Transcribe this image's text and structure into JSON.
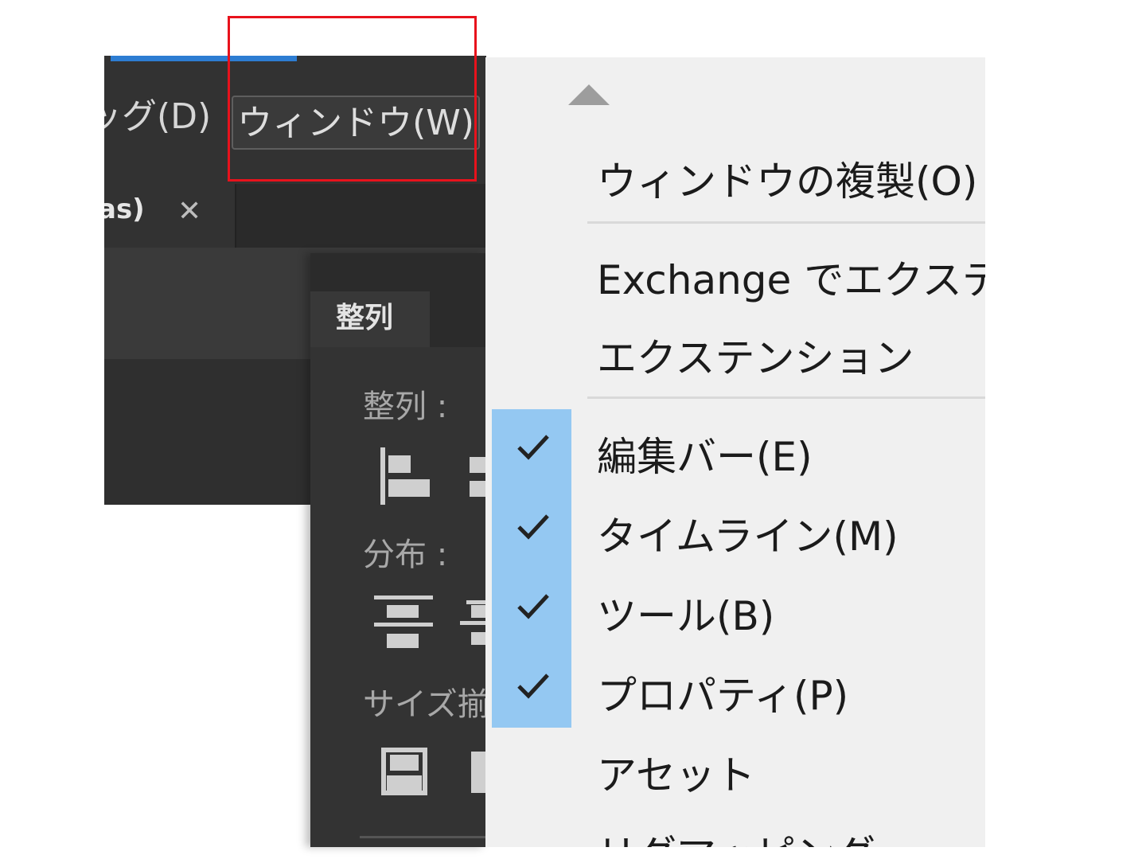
{
  "app": {
    "menubar": {
      "debug_label": "ッグ(D)",
      "window_label": "ウィンドウ(W)"
    },
    "tab": {
      "label": "as)",
      "close_glyph": "✕"
    }
  },
  "align_panel": {
    "tab_label": "整列",
    "align_label": "整列 :",
    "distribute_label": "分布 :",
    "size_label": "サイズ揃"
  },
  "context_menu": {
    "items": [
      {
        "label": "ウィンドウの複製(O)",
        "checked": false
      },
      {
        "label": "Exchange でエクステ",
        "checked": false
      },
      {
        "label": "エクステンション",
        "checked": false
      },
      {
        "label": "編集バー(E)",
        "checked": true
      },
      {
        "label": "タイムライン(M)",
        "checked": true
      },
      {
        "label": "ツール(B)",
        "checked": true
      },
      {
        "label": "プロパティ(P)",
        "checked": true
      },
      {
        "label": "アセット",
        "checked": false
      },
      {
        "label": "リグマッピング",
        "checked": false
      }
    ]
  },
  "colors": {
    "highlight": "#e8121c",
    "check_band": "#94c8f2",
    "app_accent": "#2d7dd2"
  }
}
